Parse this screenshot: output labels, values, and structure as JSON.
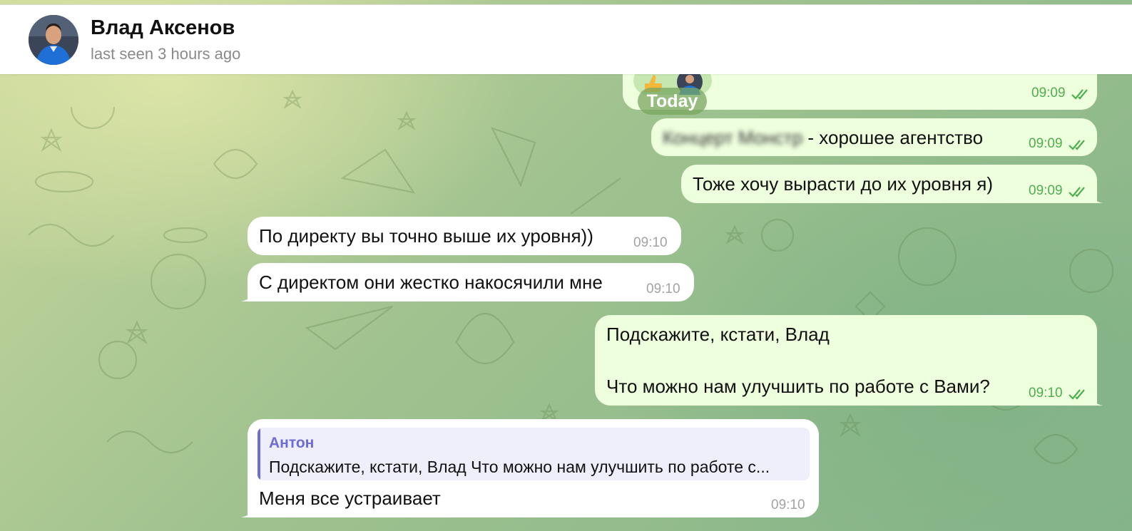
{
  "header": {
    "contact_name": "Влад Аксенов",
    "status": "last seen 3 hours ago"
  },
  "date_separator": "Today",
  "messages": [
    {
      "direction": "out",
      "text": "",
      "time": "09:09",
      "reaction": "thumbs-up"
    },
    {
      "direction": "out",
      "blurred": "Концерт Монстр",
      "text": " - хорошее агентство",
      "time": "09:09"
    },
    {
      "direction": "out",
      "text": "Тоже хочу вырасти до их уровня я)",
      "time": "09:09"
    },
    {
      "direction": "in",
      "text": "По директу вы точно выше их уровня))",
      "time": "09:10"
    },
    {
      "direction": "in",
      "text": "С директом они жестко накосячили мне",
      "time": "09:10"
    },
    {
      "direction": "out",
      "line1": "Подскажите, кстати, Влад",
      "line2": "Что можно нам улучшить по работе с Вами?",
      "time": "09:10"
    },
    {
      "direction": "in",
      "reply_author": "Антон",
      "reply_text": "Подскажите, кстати, Влад Что можно нам улучшить по работе с...",
      "text": "Меня все устраивает",
      "time": "09:10"
    }
  ],
  "colors": {
    "outgoing_bubble": "#eeffde",
    "incoming_bubble": "#ffffff",
    "read_check": "#4fae4e",
    "reply_accent": "#6d6bd8"
  },
  "icons": [
    "read-check-icon",
    "thumbs-up-icon",
    "avatar"
  ]
}
